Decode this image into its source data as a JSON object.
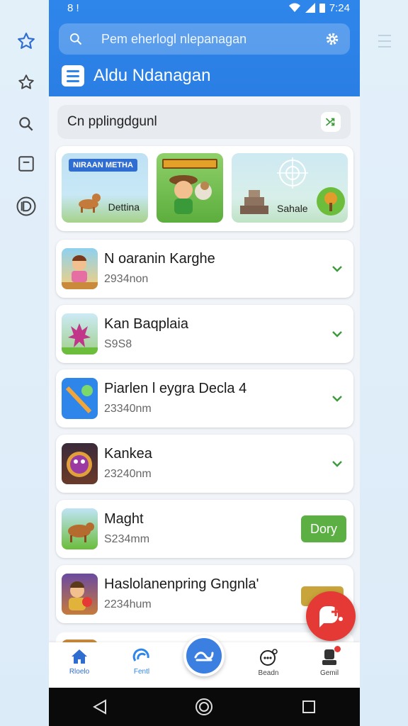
{
  "status_bar": {
    "left": "8 !",
    "time": "7:24"
  },
  "search": {
    "placeholder": "Pem eherlogl nlepanagan"
  },
  "header": {
    "title": "Aldu Ndanagan"
  },
  "filter": {
    "label": "Cn pplingdgunl"
  },
  "banners": [
    {
      "tag": "NIRAAN METHA",
      "label": "Dettina"
    },
    {
      "tag": "",
      "label": ""
    },
    {
      "tag": "",
      "label": "Sahale"
    }
  ],
  "items": [
    {
      "title": "N oaranin Karghe",
      "subtitle": "2934non",
      "action": "chevron"
    },
    {
      "title": "Kan Baqplaia",
      "subtitle": "S9S8",
      "action": "chevron"
    },
    {
      "title": "Piarlen l eygra Decla 4",
      "subtitle": "23340nm",
      "action": "chevron"
    },
    {
      "title": "Kankea",
      "subtitle": "23240nm",
      "action": "chevron"
    },
    {
      "title": "Maght",
      "subtitle": "S234mm",
      "action": "button",
      "button_label": "Dory"
    },
    {
      "title": "Haslolanenpring Gngnla'",
      "subtitle": "2234hum",
      "action": "button"
    }
  ],
  "bottom_nav": [
    {
      "label": "Rloelo",
      "icon": "home-icon"
    },
    {
      "label": "Fentl",
      "icon": "explore-icon"
    },
    {
      "label": "",
      "icon": "add-icon"
    },
    {
      "label": "Beadn",
      "icon": "chat-icon"
    },
    {
      "label": "Gemil",
      "icon": "profile-icon"
    }
  ],
  "colors": {
    "accent": "#2f86ea",
    "success": "#5cb043",
    "fab": "#e53935"
  }
}
